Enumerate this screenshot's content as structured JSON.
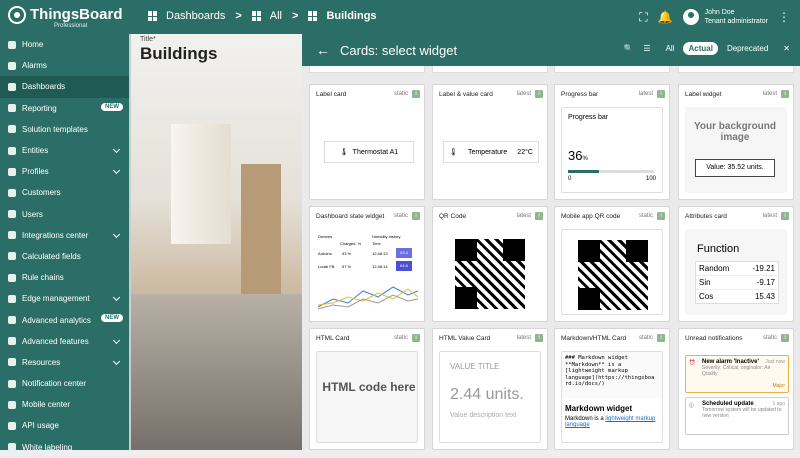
{
  "topbar": {
    "brand": "ThingsBoard",
    "brand_sub": "Professional",
    "crumbs": [
      "Dashboards",
      "All",
      "Buildings"
    ],
    "user": {
      "name": "John Doe",
      "role": "Tenant administrator"
    }
  },
  "sidebar": {
    "items": [
      {
        "label": "Home"
      },
      {
        "label": "Alarms"
      },
      {
        "label": "Dashboards"
      },
      {
        "label": "Reporting",
        "badge": "NEW"
      },
      {
        "label": "Solution templates"
      },
      {
        "label": "Entities"
      },
      {
        "label": "Profiles"
      },
      {
        "label": "Customers"
      },
      {
        "label": "Users"
      },
      {
        "label": "Integrations center"
      },
      {
        "label": "Calculated fields"
      },
      {
        "label": "Rule chains"
      },
      {
        "label": "Edge management"
      },
      {
        "label": "Advanced analytics",
        "badge": "NEW"
      },
      {
        "label": "Advanced features"
      },
      {
        "label": "Resources"
      },
      {
        "label": "Notification center"
      },
      {
        "label": "Mobile center"
      },
      {
        "label": "API usage"
      },
      {
        "label": "White labeling"
      }
    ]
  },
  "dashboard": {
    "title_caption": "Title*",
    "title": "Buildings"
  },
  "panel": {
    "title": "Cards: select widget",
    "filters": [
      "All",
      "Actual",
      "Deprecated"
    ]
  },
  "cards": [
    {
      "title": "Label card",
      "tag": "static",
      "content": "Thermostat A1"
    },
    {
      "title": "Label & value card",
      "tag": "latest",
      "label": "Temperature",
      "value": "22°C"
    },
    {
      "title": "Progress bar",
      "tag": "latest",
      "sub": "Progress bar",
      "value": "36",
      "unit": "%",
      "min": "0",
      "max": "100"
    },
    {
      "title": "Label widget",
      "tag": "latest",
      "bg": "Your background image",
      "value": "Value: 35.52 units."
    },
    {
      "title": "Dashboard state widget",
      "tag": "static",
      "devices": "Devices",
      "charged": "Charged, %",
      "history": "Humidity history",
      "time": "Time",
      "rows": [
        [
          "Arduino",
          "93 %",
          "12:48:13",
          "53.4"
        ],
        [
          "Lorab FB",
          "57 %",
          "12:48:14",
          "64.6"
        ]
      ]
    },
    {
      "title": "QR Code",
      "tag": "latest"
    },
    {
      "title": "Mobile app QR code",
      "tag": "static"
    },
    {
      "title": "Attributes card",
      "tag": "latest",
      "fn": "Function",
      "rows": [
        [
          "Random",
          "-19.21"
        ],
        [
          "Sin",
          "-9.17"
        ],
        [
          "Cos",
          "15.43"
        ]
      ]
    },
    {
      "title": "HTML Card",
      "tag": "static",
      "content": "HTML code here"
    },
    {
      "title": "HTML Value Card",
      "tag": "latest",
      "label": "VALUE TITLE",
      "value": "2.44 units.",
      "desc": "Value description text"
    },
    {
      "title": "Markdown/HTML Card",
      "tag": "static",
      "code": [
        "### Markdown widget",
        "",
        "**Markdown** is a",
        "[lightweight markup",
        "language](https://thingsboa",
        "rd.io/docs/)"
      ],
      "heading": "Markdown widget",
      "text": "Markdown is a ",
      "link": "lightweight markup language"
    },
    {
      "title": "Unread notifications",
      "tag": "static",
      "n1": "New alarm 'Inactive'",
      "n1d": "Severity: Critical, originator: Air Quality",
      "n1t": "Just now",
      "n1b": "Major",
      "n2": "Scheduled update",
      "n2d": "Tomorrow system will be updated to new version",
      "n2t": "1 ago"
    }
  ]
}
